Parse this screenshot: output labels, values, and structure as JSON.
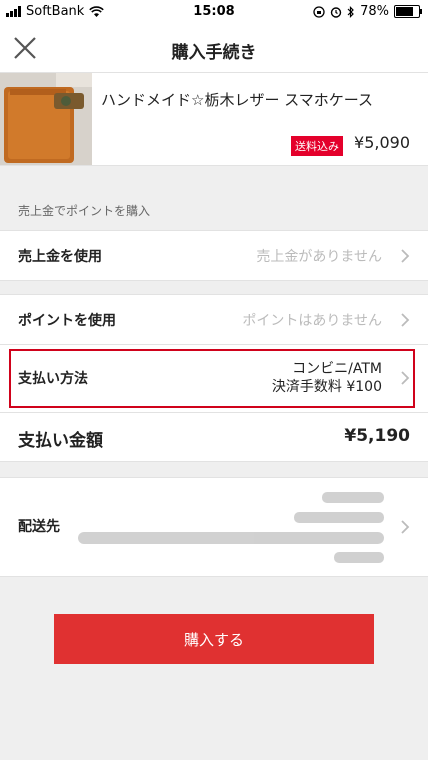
{
  "status_bar": {
    "carrier": "SoftBank",
    "time": "15:08",
    "battery": "78%",
    "battery_level": 0.78,
    "icons": [
      "signal-icon",
      "wifi-icon",
      "orientation-lock-icon",
      "alarm-icon",
      "bluetooth-icon",
      "battery-icon"
    ]
  },
  "nav": {
    "title": "購入手続き",
    "close_icon": "close-icon"
  },
  "product": {
    "name": "ハンドメイド☆栃木レザー スマホケース",
    "shipping_badge": "送料込み",
    "price": "¥5,090"
  },
  "section": {
    "points_purchase_label": "売上金でポイントを購入"
  },
  "rows": {
    "sales_label": "売上金を使用",
    "sales_value": "売上金がありません",
    "points_label": "ポイントを使用",
    "points_value": "ポイントはありません",
    "payment_label": "支払い方法",
    "payment_value_1": "コンビニ/ATM",
    "payment_value_2": "決済手数料 ¥100",
    "total_label": "支払い金額",
    "total_value": "¥5,190",
    "shipping_label": "配送先"
  },
  "buy_button": {
    "label": "購入する"
  },
  "colors": {
    "accent": "#e03131",
    "badge": "#e4002b",
    "highlight": "#d0021b"
  }
}
